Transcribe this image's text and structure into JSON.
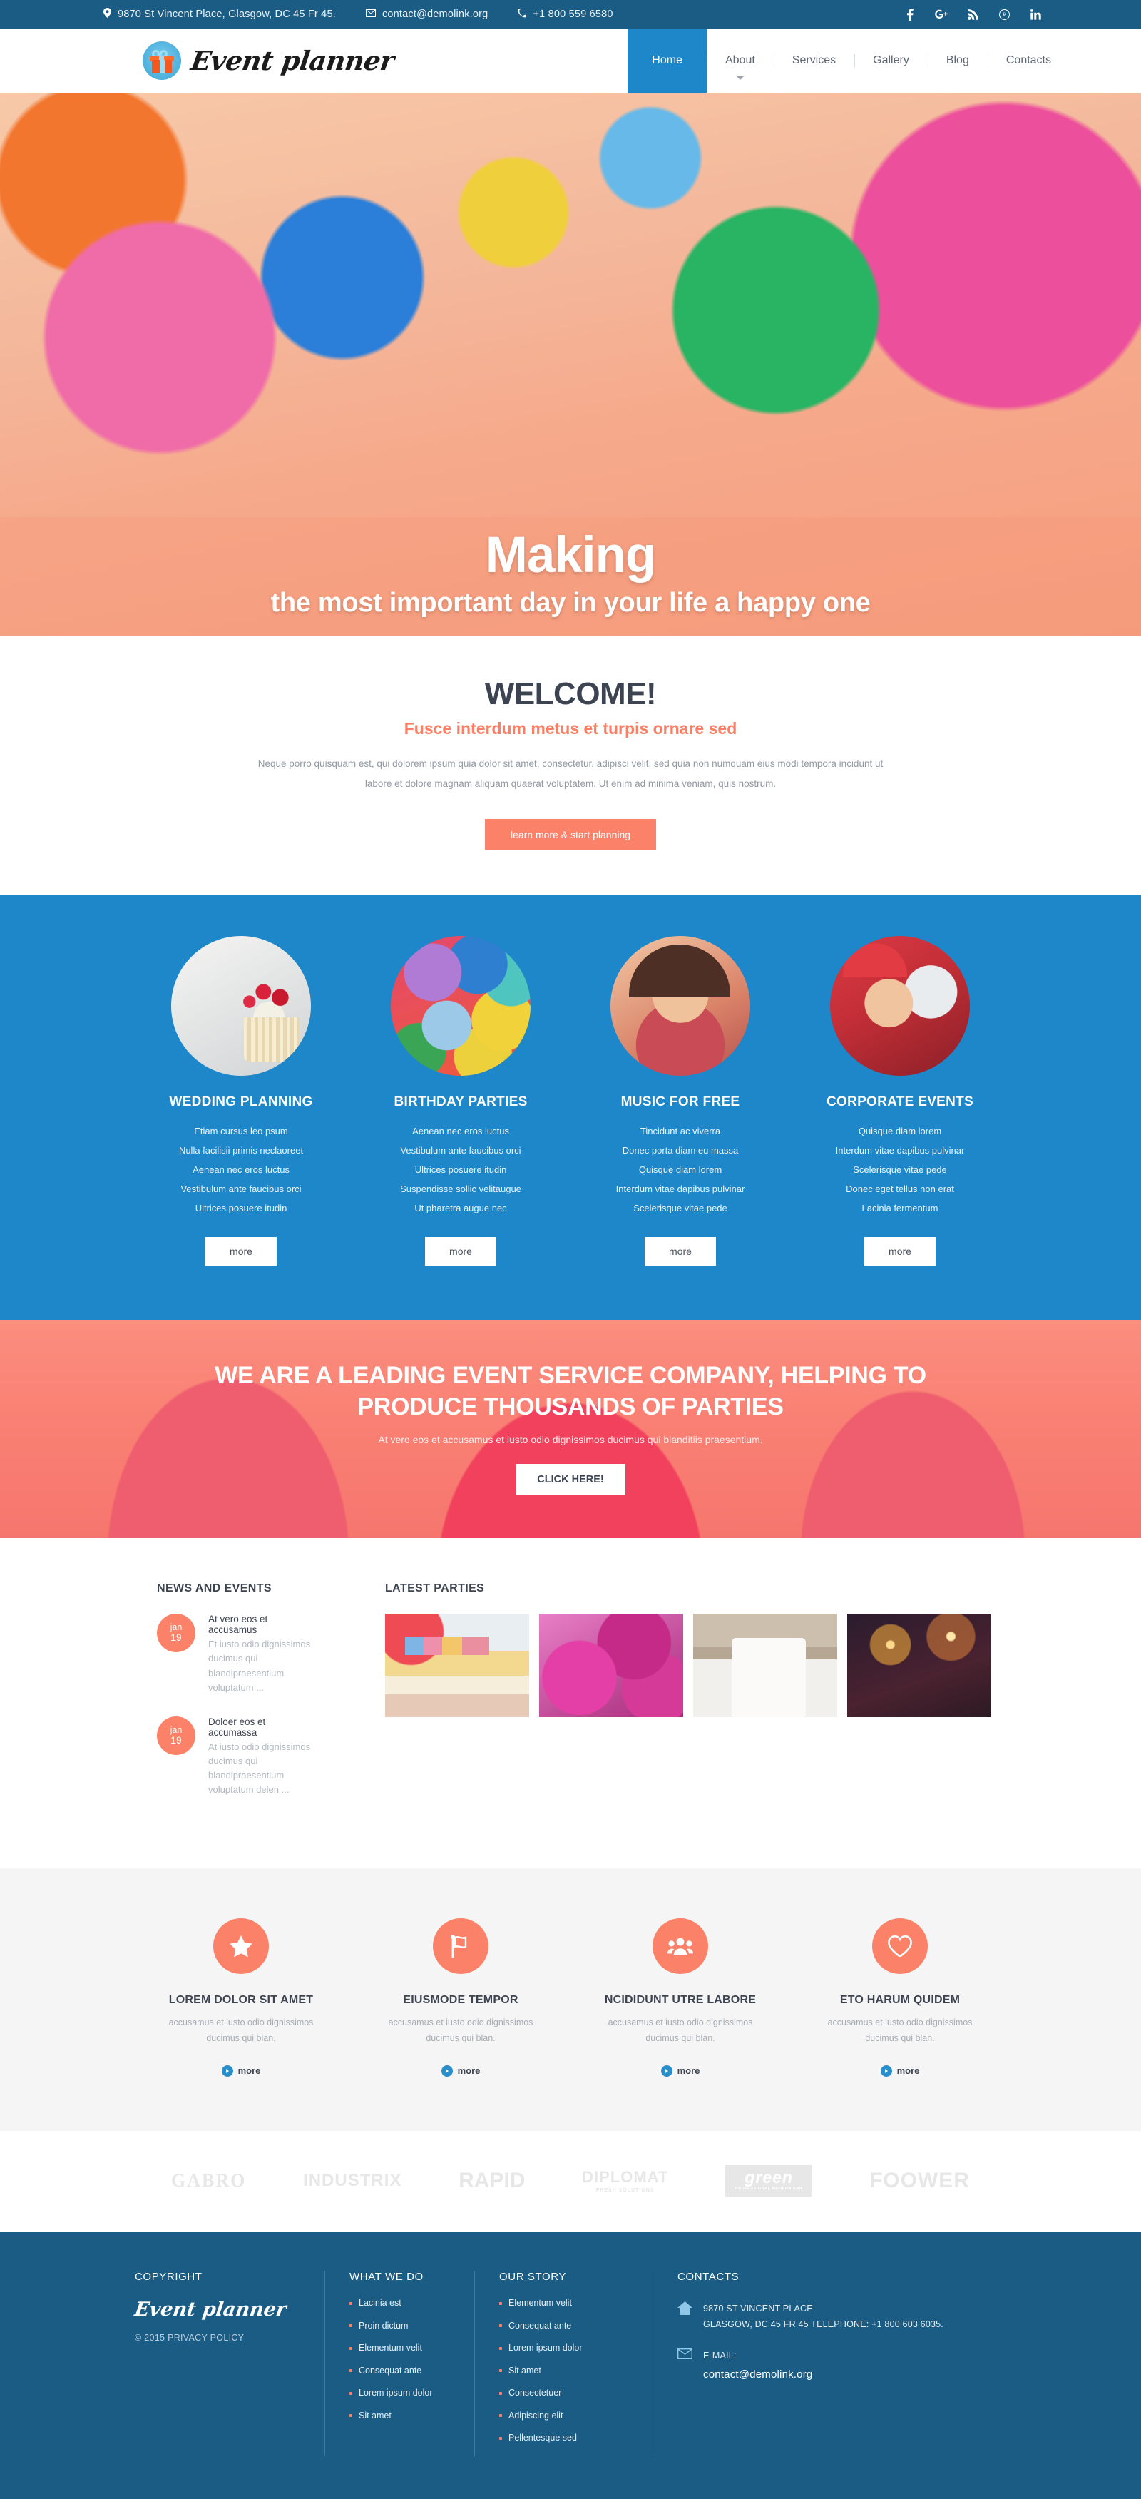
{
  "topbar": {
    "address": "9870 St Vincent Place, Glasgow, DC 45 Fr 45.",
    "email": "contact@demolink.org",
    "phone": "+1 800 559 6580",
    "social": [
      {
        "name": "facebook-icon",
        "glyph": "f"
      },
      {
        "name": "google-plus-icon",
        "glyph": "g+"
      },
      {
        "name": "rss-icon",
        "glyph": "˿"
      },
      {
        "name": "pinterest-icon",
        "glyph": "Ⓟ"
      },
      {
        "name": "linkedin-icon",
        "glyph": "in"
      }
    ]
  },
  "header": {
    "brand": "Event planner",
    "nav": [
      {
        "label": "Home",
        "active": true,
        "dropdown": false
      },
      {
        "label": "About",
        "active": false,
        "dropdown": true
      },
      {
        "label": "Services",
        "active": false,
        "dropdown": false
      },
      {
        "label": "Gallery",
        "active": false,
        "dropdown": false
      },
      {
        "label": "Blog",
        "active": false,
        "dropdown": false
      },
      {
        "label": "Contacts",
        "active": false,
        "dropdown": false
      }
    ]
  },
  "hero": {
    "title": "Making",
    "subtitle": "the most important day in your life a happy one",
    "slides": 3,
    "active_slide": 1
  },
  "welcome": {
    "heading": "WELCOME!",
    "subheading": "Fusce interdum metus et turpis ornare sed",
    "body": "Neque porro quisquam est, qui dolorem ipsum quia dolor sit amet, consectetur, adipisci velit, sed quia non numquam eius modi tempora incidunt ut labore et dolore magnam aliquam quaerat voluptatem. Ut enim ad minima veniam, quis nostrum.",
    "cta": "learn more & start planning"
  },
  "services": {
    "more_label": "more",
    "items": [
      {
        "title": "WEDDING PLANNING",
        "image": "cupcake-photo",
        "lines": [
          "Etiam cursus leo psum",
          "Nulla facilisii primis neclaoreet",
          "Aenean nec eros luctus",
          "Vestibulum ante faucibus orci",
          "Ultrices posuere itudin"
        ]
      },
      {
        "title": "BIRTHDAY PARTIES",
        "image": "balloons-photo",
        "lines": [
          "Aenean nec eros luctus",
          "Vestibulum ante faucibus orci",
          "Ultrices posuere itudin",
          "Suspendisse sollic velitaugue",
          "Ut pharetra augue nec"
        ]
      },
      {
        "title": "MUSIC FOR FREE",
        "image": "girl-phone-photo",
        "lines": [
          "Tincidunt ac viverra",
          "Donec porta diam eu massa",
          "Quisque diam lorem",
          "Interdum vitae dapibus pulvinar",
          "Scelerisque vitae pede"
        ]
      },
      {
        "title": "CORPORATE EVENTS",
        "image": "santa-photo",
        "lines": [
          "Quisque diam lorem",
          "Interdum vitae dapibus pulvinar",
          "Scelerisque vitae pede",
          "Donec eget tellus non erat",
          "Lacinia fermentum"
        ]
      }
    ]
  },
  "cta": {
    "heading": "WE ARE A LEADING EVENT SERVICE COMPANY, HELPING TO PRODUCE THOUSANDS OF PARTIES",
    "text": "At vero eos et accusamus et iusto odio dignissimos ducimus qui blanditiis praesentium.",
    "button": "CLICK HERE!"
  },
  "news": {
    "title": "NEWS AND EVENTS",
    "items": [
      {
        "month": "jan",
        "day": "19",
        "title": "At vero eos et accusamus",
        "text": "Et iusto odio dignissimos ducimus qui blandipraesentium voluptatum ..."
      },
      {
        "month": "jan",
        "day": "19",
        "title": "Doloer eos et accumassa",
        "text": "At iusto odio dignissimos ducimus qui blandipraesentium voluptatum delen ..."
      }
    ]
  },
  "gallery": {
    "title": "LATEST PARTIES",
    "items": [
      {
        "name": "party-cake-photo"
      },
      {
        "name": "pink-roses-photo"
      },
      {
        "name": "wedding-cake-photo"
      },
      {
        "name": "fireworks-photo"
      }
    ]
  },
  "features": {
    "more_label": "more",
    "items": [
      {
        "icon": "star-icon",
        "title": "LOREM DOLOR SIT AMET",
        "text": "accusamus et iusto odio dignissimos ducimus qui blan."
      },
      {
        "icon": "flag-icon",
        "title": "EIUSMODE TEMPOR",
        "text": "accusamus et iusto odio dignissimos ducimus qui blan."
      },
      {
        "icon": "users-icon",
        "title": "NCIDIDUNT UTRE LABORE",
        "text": "accusamus et iusto odio dignissimos ducimus qui blan."
      },
      {
        "icon": "heart-icon",
        "title": "ETO HARUM QUIDEM",
        "text": "accusamus et iusto odio dignissimos ducimus qui blan."
      }
    ]
  },
  "partners": [
    {
      "name": "gabro-logo",
      "label": "GABRO"
    },
    {
      "name": "industrix-logo",
      "label": "INDUSTRIX"
    },
    {
      "name": "rapid-logo",
      "label": "RAPID"
    },
    {
      "name": "diplomat-logo",
      "label": "DIPLOMAT",
      "sub": "FRESH SOLUTIONS"
    },
    {
      "name": "green-logo",
      "label": "green",
      "sub": "PROFESSIONAL MODERN BAR"
    },
    {
      "name": "foower-logo",
      "label": "FOOWER"
    }
  ],
  "footer": {
    "copyright_title": "COPYRIGHT",
    "brand": "Event planner",
    "copyright_line": "© 2015 PRIVACY POLICY",
    "what_we_do_title": "WHAT WE DO",
    "what_we_do": [
      "Lacinia est",
      "Proin dictum",
      "Elementum velit",
      "Consequat ante",
      "Lorem ipsum dolor",
      "Sit amet"
    ],
    "our_story_title": "OUR STORY",
    "our_story": [
      "Elementum velit",
      "Consequat ante",
      "Lorem ipsum dolor",
      "Sit amet",
      "Consectetuer",
      "Adipiscing elit",
      "Pellentesque sed"
    ],
    "contacts_title": "CONTACTS",
    "address_line1": "9870 ST VINCENT PLACE,",
    "address_line2": "GLASGOW, DC 45 FR 45 TELEPHONE: +1 800 603 6035.",
    "email_label": "E-MAIL:",
    "email": "contact@demolink.org"
  },
  "colors": {
    "brand_blue": "#1e87c9",
    "dark_blue": "#1b5c85",
    "coral": "#fb8268",
    "text_dark": "#3d4451"
  }
}
